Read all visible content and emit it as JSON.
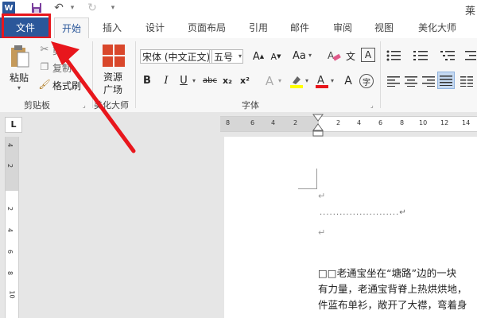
{
  "window": {
    "title": "莱"
  },
  "quick_access": {
    "word_icon": "W",
    "save_icon": "save-icon",
    "undo_icon": "undo-icon",
    "redo_icon": "redo-icon"
  },
  "tabs": [
    {
      "label": "文件"
    },
    {
      "label": "开始"
    },
    {
      "label": "插入"
    },
    {
      "label": "设计"
    },
    {
      "label": "页面布局"
    },
    {
      "label": "引用"
    },
    {
      "label": "邮件"
    },
    {
      "label": "审阅"
    },
    {
      "label": "视图"
    },
    {
      "label": "美化大师"
    }
  ],
  "ribbon": {
    "clipboard": {
      "paste": "粘贴",
      "cut": "剪切",
      "copy": "复制",
      "format_painter": "格式刷",
      "group_label": "剪贴板"
    },
    "beautify": {
      "square": "资源",
      "plaza": "广场",
      "group_label": "美化大师"
    },
    "font": {
      "font_name": "宋体 (中文正文)",
      "font_size": "五号",
      "bold": "B",
      "italic": "I",
      "underline": "U",
      "strikethrough": "abc",
      "subscript": "x₂",
      "superscript": "x²",
      "change_case": "Aa",
      "char_border": "A",
      "phonetic": "文",
      "enclosed": "字",
      "group_label": "字体"
    }
  },
  "ruler": {
    "corner": "L",
    "h_ticks": [
      "8",
      "6",
      "4",
      "2",
      "2",
      "4",
      "6",
      "8",
      "10",
      "12",
      "14"
    ],
    "v_ticks": [
      "4",
      "2",
      "2",
      "4",
      "6",
      "8",
      "10"
    ]
  },
  "document": {
    "para_mark": "↵",
    "dots": "........................↵",
    "lines": [
      "□□老通宝坐在“塘路”边的一块",
      "有力量，老通宝背脊上热烘烘地，",
      "件蓝布单衫，敞开了大襟，弯着身"
    ]
  },
  "colors": {
    "accent": "#2b579a",
    "highlight": "#e8161c",
    "ribbon_bg": "#f7f7f7"
  }
}
